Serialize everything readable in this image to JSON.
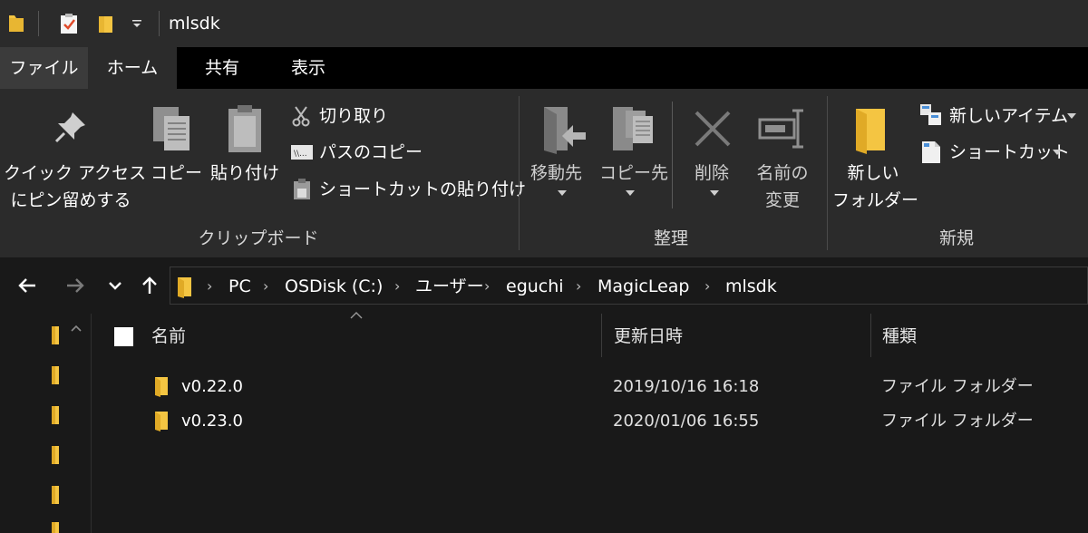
{
  "window": {
    "title": "mlsdk"
  },
  "tabs": [
    {
      "label": "ファイル"
    },
    {
      "label": "ホーム"
    },
    {
      "label": "共有"
    },
    {
      "label": "表示"
    }
  ],
  "ribbon": {
    "clipboard": {
      "group_label": "クリップボード",
      "pin_line1": "クイック アクセス",
      "pin_line2": "にピン留めする",
      "copy": "コピー",
      "paste": "貼り付け",
      "cut": "切り取り",
      "copy_path": "パスのコピー",
      "paste_shortcut": "ショートカットの貼り付け"
    },
    "organize": {
      "group_label": "整理",
      "move_to": "移動先",
      "copy_to": "コピー先",
      "delete": "削除",
      "rename_line1": "名前の",
      "rename_line2": "変更"
    },
    "new": {
      "group_label": "新規",
      "new_folder_line1": "新しい",
      "new_folder_line2": "フォルダー",
      "new_item": "新しいアイテム",
      "shortcut": "ショートカット"
    }
  },
  "address": {
    "crumbs": [
      "PC",
      "OSDisk (C:)",
      "ユーザー",
      "eguchi",
      "MagicLeap",
      "mlsdk"
    ]
  },
  "columns": {
    "name": "名前",
    "modified": "更新日時",
    "type": "種類"
  },
  "rows": [
    {
      "name": "v0.22.0",
      "modified": "2019/10/16 16:18",
      "type": "ファイル フォルダー"
    },
    {
      "name": "v0.23.0",
      "modified": "2020/01/06 16:55",
      "type": "ファイル フォルダー"
    }
  ],
  "colors": {
    "folder": "#f4c542",
    "titlebar": "#2b2b2b",
    "background": "#191919"
  }
}
